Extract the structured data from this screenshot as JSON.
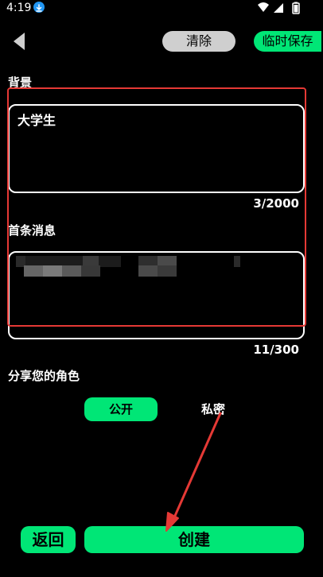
{
  "status_bar": {
    "time": "4:19",
    "icons": [
      "download-icon",
      "wifi-icon",
      "signal-icon",
      "battery-icon"
    ]
  },
  "header": {
    "back_icon": "back-arrow-icon",
    "clear_label": "清除",
    "save_label": "临时保存"
  },
  "background_section": {
    "label": "背景",
    "value": "大学生",
    "counter": "3/2000"
  },
  "first_message_section": {
    "label": "首条消息",
    "value_obscured": true,
    "counter": "11/300"
  },
  "share_section": {
    "label": "分享您的角色",
    "options": [
      "公开",
      "私密"
    ],
    "selected": "公开"
  },
  "footer": {
    "return_label": "返回",
    "create_label": "创建"
  },
  "colors": {
    "background": "#000000",
    "accent_green": "#00e676",
    "clear_gray": "#cfcfcf",
    "annotation_red": "#e53935",
    "text": "#ffffff"
  }
}
